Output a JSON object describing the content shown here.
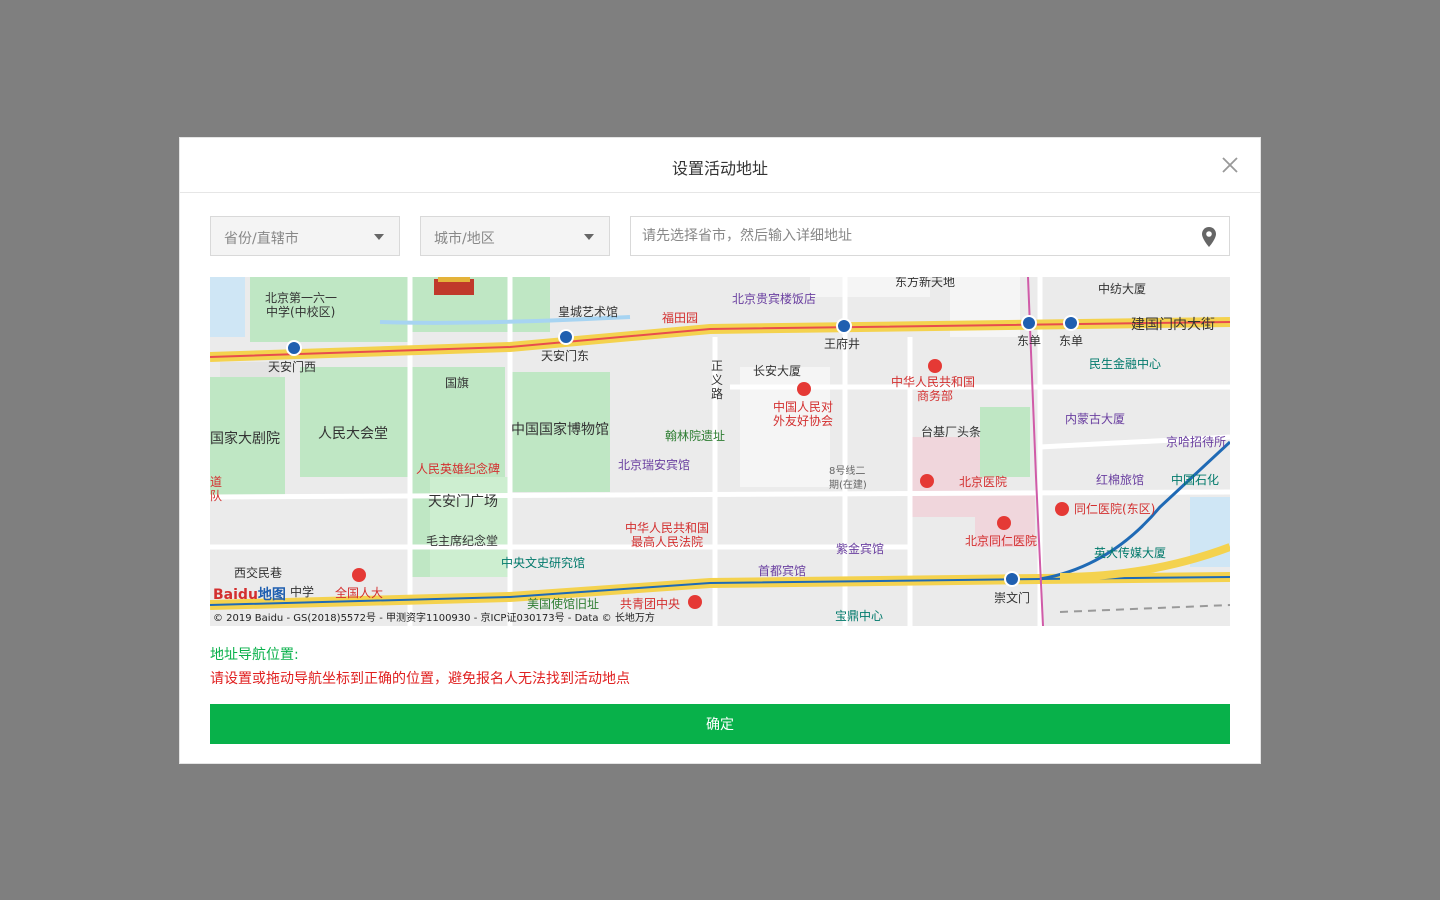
{
  "dialog": {
    "title": "设置活动地址",
    "close_icon": "close-icon"
  },
  "form": {
    "province_select": {
      "value": "省份/直辖市"
    },
    "city_select": {
      "value": "城市/地区"
    },
    "address_input": {
      "placeholder": "请先选择省市，然后输入详细地址",
      "icon": "location-pin-icon"
    }
  },
  "map": {
    "provider": "Baidu",
    "logo_text": "地图",
    "copyright": "© 2019 Baidu - GS(2018)5572号 - 甲测资字1100930 - 京ICP证030173号 - Data © 长地万方",
    "labels": {
      "dongfang": "东方新天地",
      "zhongfang": "中纺大厦",
      "bj161": "北京第一六一",
      "bj161b": "中学(中校区)",
      "huangcheng": "皇城艺术馆",
      "guibin": "北京贵宾楼饭店",
      "futianyuan": "福田园",
      "jianguomen": "建国门内大街",
      "tiananmenxi": "天安门西",
      "tiananmendong": "天安门东",
      "wangfujing": "王府井",
      "dongdan1": "东单",
      "dongdan2": "东单",
      "zhengyilu": "正\n义\n路",
      "changan": "长安大厦",
      "minsheng": "民生金融中心",
      "guoqi": "国旗",
      "zhonghua1": "中华人民共和国",
      "zhonghua1b": "商务部",
      "youxie1": "中国人民对",
      "youxie2": "外友好协会",
      "neimenggu": "内蒙古大厦",
      "guojia_theater": "国家大剧院",
      "renda_hall": "人民大会堂",
      "museum": "中国国家博物馆",
      "hanlin": "翰林院遗址",
      "taiji": "台基厂头条",
      "jingha": "京哈招待所",
      "monument": "人民英雄纪念碑",
      "ruian": "北京瑞安宾馆",
      "line8": "8号线二\n期(在建)",
      "bj_hospital": "北京医院",
      "hongmian": "红棉旅馆",
      "sinopec": "中国石化",
      "square": "天安门广场",
      "court1": "中华人民共和国",
      "court2": "最高人民法院",
      "tongren_east": "同仁医院(东区)",
      "mausoleum": "毛主席纪念堂",
      "zijin": "紫金宾馆",
      "bj_tongren": "北京同仁医院",
      "yingda": "英大传媒大厦",
      "wenshi": "中央文史研究馆",
      "xijiao": "西交民巷",
      "shoudu": "首都宾馆",
      "zhongxue": "中学",
      "npc": "全国人大",
      "chongwenmen": "崇文门",
      "us_embassy": "美国使馆旧址",
      "youth_league": "共青团中央",
      "baoding": "宝鼎中心",
      "dao": "道",
      "dui": "队"
    }
  },
  "hint": {
    "title": "地址导航位置:",
    "text": "请设置或拖动导航坐标到正确的位置，避免报名人无法找到活动地点"
  },
  "confirm_button": {
    "label": "确定"
  },
  "colors": {
    "accent_green": "#08b14a",
    "warning_red": "#e02020",
    "overlay": "#7f7f7f"
  }
}
